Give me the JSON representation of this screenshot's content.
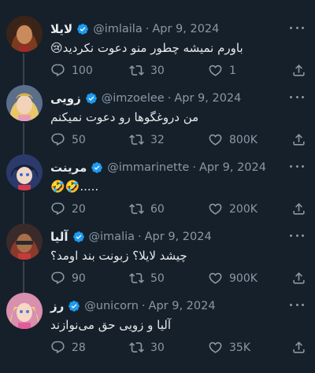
{
  "tweets": [
    {
      "name": "لایلا",
      "handle": "@imlaila",
      "date": "Apr 9, 2024",
      "text": "باورم نمیشه چطور منو دعوت نکردید😢",
      "replies": "100",
      "retweets": "30",
      "likes": "1"
    },
    {
      "name": "زویی",
      "handle": "@imzoelee",
      "date": "Apr 9, 2024",
      "text": "من دروغگوها رو دعوت نمیکنم",
      "replies": "50",
      "retweets": "32",
      "likes": "800K"
    },
    {
      "name": "مرینت",
      "handle": "@immarinette",
      "date": "Apr 9, 2024",
      "text": "🤣🤣.....",
      "replies": "20",
      "retweets": "60",
      "likes": "200K"
    },
    {
      "name": "آلیا",
      "handle": "@imalia",
      "date": "Apr 9, 2024",
      "text": "چیشد لایلا؟ زبونت بند اومد؟",
      "replies": "90",
      "retweets": "50",
      "likes": "900K"
    },
    {
      "name": "رز",
      "handle": "@unicorn",
      "date": "Apr 9, 2024",
      "text": "آلیا و زویی حق می‌نوازند",
      "replies": "28",
      "retweets": "30",
      "likes": "35K"
    }
  ],
  "separator": "·",
  "colors": {
    "background": "#15202b",
    "text": "#e7e9ea",
    "secondary": "#8b98a5",
    "verified": "#1d9bf0",
    "thread_line": "#38444d"
  },
  "icons": {
    "reply": "reply-icon",
    "retweet": "retweet-icon",
    "like": "heart-icon",
    "share": "share-icon",
    "more": "more-icon",
    "verified": "verified-badge-icon"
  }
}
